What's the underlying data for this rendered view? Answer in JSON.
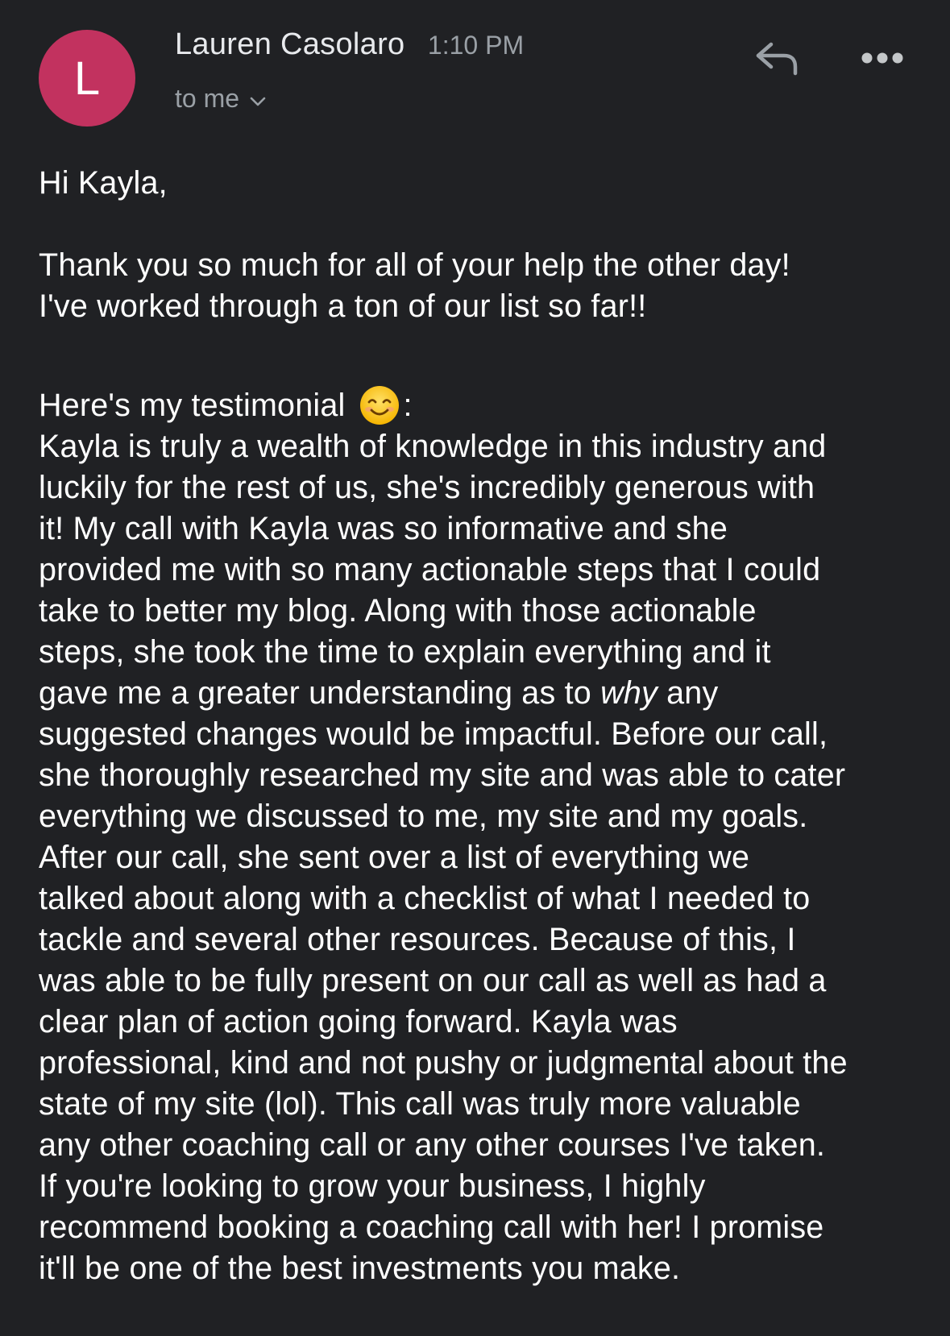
{
  "colors": {
    "background": "#202124",
    "avatar_bg": "#c2325f",
    "text_primary": "#ffffff",
    "text_secondary": "#9aa0a6"
  },
  "header": {
    "avatar_letter": "L",
    "sender_name": "Lauren Casolaro",
    "time": "1:10 PM",
    "recipient": "to me",
    "icons": {
      "reply": "reply-icon",
      "more": "more-options-icon",
      "recipient_toggle": "chevron-down-icon"
    }
  },
  "email": {
    "greeting": "Hi Kayla,",
    "intro": [
      "Thank you so much for all of your help the other day!",
      "I've worked through a ton of our list so far!!"
    ],
    "testimonial_intro": "Here's my testimonial",
    "testimonial_intro_suffix": ":",
    "testimonial_emoji": "smiling-face-emoji",
    "testimonial_lines": [
      "Kayla is truly a wealth of knowledge in this industry and",
      "luckily for the rest of us, she's incredibly generous with",
      "it! My call with Kayla was so informative and she",
      "provided me with so many actionable steps that I could",
      "take to better my blog. Along with those actionable",
      "steps, she took the time to explain everything and it",
      "gave me a greater understanding as to ",
      "suggested changes would be impactful. Before our call,",
      "she thoroughly researched my site and was able to cater",
      "everything we discussed to me, my site and my goals.",
      "After our call, she sent over a list of everything we",
      "talked about along with a checklist of what I needed to",
      "tackle and several other resources. Because of this, I",
      "was able to be fully present on our call as well as had a",
      "clear plan of action going forward. Kayla was",
      "professional, kind and not pushy or judgmental about the",
      "state of my site (lol). This call was truly more valuable",
      "any other coaching call or any other courses I've taken.",
      "If you're looking to grow your business, I highly",
      "recommend booking a coaching call with her! I promise",
      "it'll be one of the best investments you make."
    ],
    "emphasis_word": "why",
    "emphasis_after": " any"
  }
}
